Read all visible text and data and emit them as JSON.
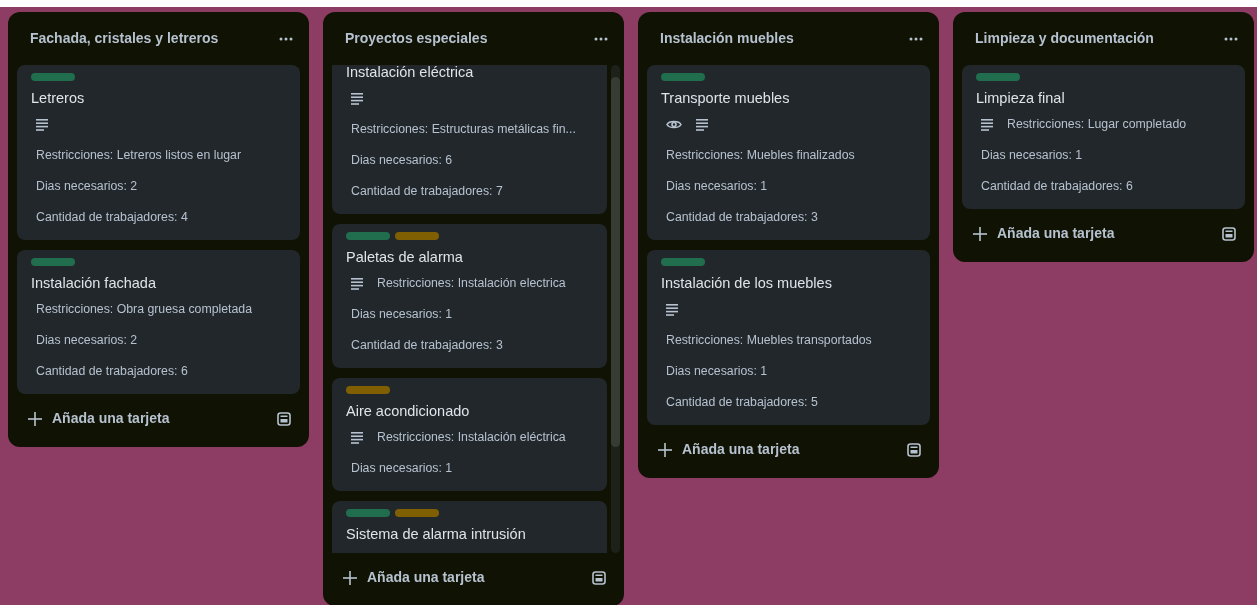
{
  "columns": [
    {
      "title": "Fachada, cristales y letreros",
      "scrollable": false,
      "add_label": "Añada una tarjeta",
      "cards": [
        {
          "labels": [
            {
              "color": "#216e4e"
            }
          ],
          "title": "Letreros",
          "rows": [
            [
              {
                "kind": "description"
              }
            ],
            [
              {
                "kind": "text",
                "text": "Restricciones: Letreros listos en lugar"
              }
            ],
            [
              {
                "kind": "text",
                "text": "Dias necesarios: 2"
              }
            ],
            [
              {
                "kind": "text",
                "text": "Cantidad de trabajadores: 4"
              }
            ]
          ]
        },
        {
          "labels": [
            {
              "color": "#216e4e"
            }
          ],
          "title": "Instalación fachada",
          "rows": [
            [
              {
                "kind": "text",
                "text": "Restricciones: Obra gruesa completada"
              }
            ],
            [
              {
                "kind": "text",
                "text": "Dias necesarios: 2"
              }
            ],
            [
              {
                "kind": "text",
                "text": "Cantidad de trabajadores: 6"
              }
            ]
          ]
        }
      ]
    },
    {
      "title": "Proyectos especiales",
      "scrollable": true,
      "add_label": "Añada una tarjeta",
      "cards": [
        {
          "title": "Instalación eléctrica",
          "rows": [
            [
              {
                "kind": "description"
              }
            ],
            [
              {
                "kind": "text",
                "text": "Restricciones: Estructuras metálicas fin..."
              }
            ],
            [
              {
                "kind": "text",
                "text": "Dias necesarios: 6"
              }
            ],
            [
              {
                "kind": "text",
                "text": "Cantidad de trabajadores: 7"
              }
            ]
          ]
        },
        {
          "labels": [
            {
              "color": "#216e4e"
            },
            {
              "color": "#7f5f01"
            }
          ],
          "title": "Paletas de alarma",
          "rows": [
            [
              {
                "kind": "description"
              },
              {
                "kind": "text",
                "text": "Restricciones: Instalación electrica"
              }
            ],
            [
              {
                "kind": "text",
                "text": "Dias necesarios: 1"
              }
            ],
            [
              {
                "kind": "text",
                "text": "Cantidad de trabajadores: 3"
              }
            ]
          ]
        },
        {
          "labels": [
            {
              "color": "#7f5f01"
            }
          ],
          "title": "Aire acondicionado",
          "rows": [
            [
              {
                "kind": "description"
              },
              {
                "kind": "text",
                "text": "Restricciones: Instalación eléctrica"
              }
            ],
            [
              {
                "kind": "text",
                "text": "Dias necesarios: 1"
              }
            ]
          ]
        },
        {
          "labels": [
            {
              "color": "#216e4e"
            },
            {
              "color": "#7f5f01"
            }
          ],
          "title": "Sistema de alarma intrusión"
        }
      ]
    },
    {
      "title": "Instalación muebles",
      "scrollable": false,
      "add_label": "Añada una tarjeta",
      "cards": [
        {
          "labels": [
            {
              "color": "#216e4e"
            }
          ],
          "title": "Transporte muebles",
          "rows": [
            [
              {
                "kind": "watch"
              },
              {
                "kind": "description"
              }
            ],
            [
              {
                "kind": "text",
                "text": "Restricciones: Muebles finalizados"
              }
            ],
            [
              {
                "kind": "text",
                "text": "Dias necesarios: 1"
              }
            ],
            [
              {
                "kind": "text",
                "text": "Cantidad de trabajadores: 3"
              }
            ]
          ]
        },
        {
          "labels": [
            {
              "color": "#216e4e"
            }
          ],
          "title": "Instalación de los muebles",
          "rows": [
            [
              {
                "kind": "description"
              }
            ],
            [
              {
                "kind": "text",
                "text": "Restricciones: Muebles transportados"
              }
            ],
            [
              {
                "kind": "text",
                "text": "Dias necesarios: 1"
              }
            ],
            [
              {
                "kind": "text",
                "text": "Cantidad de trabajadores: 5"
              }
            ]
          ]
        }
      ]
    },
    {
      "title": "Limpieza y documentación",
      "scrollable": false,
      "add_label": "Añada una tarjeta",
      "cards": [
        {
          "labels": [
            {
              "color": "#216e4e"
            }
          ],
          "title": "Limpieza final",
          "rows": [
            [
              {
                "kind": "description"
              },
              {
                "kind": "text",
                "text": "Restricciones: Lugar completado"
              }
            ],
            [
              {
                "kind": "text",
                "text": "Dias necesarios: 1"
              }
            ],
            [
              {
                "kind": "text",
                "text": "Cantidad de trabajadores: 6"
              }
            ]
          ]
        }
      ]
    }
  ]
}
